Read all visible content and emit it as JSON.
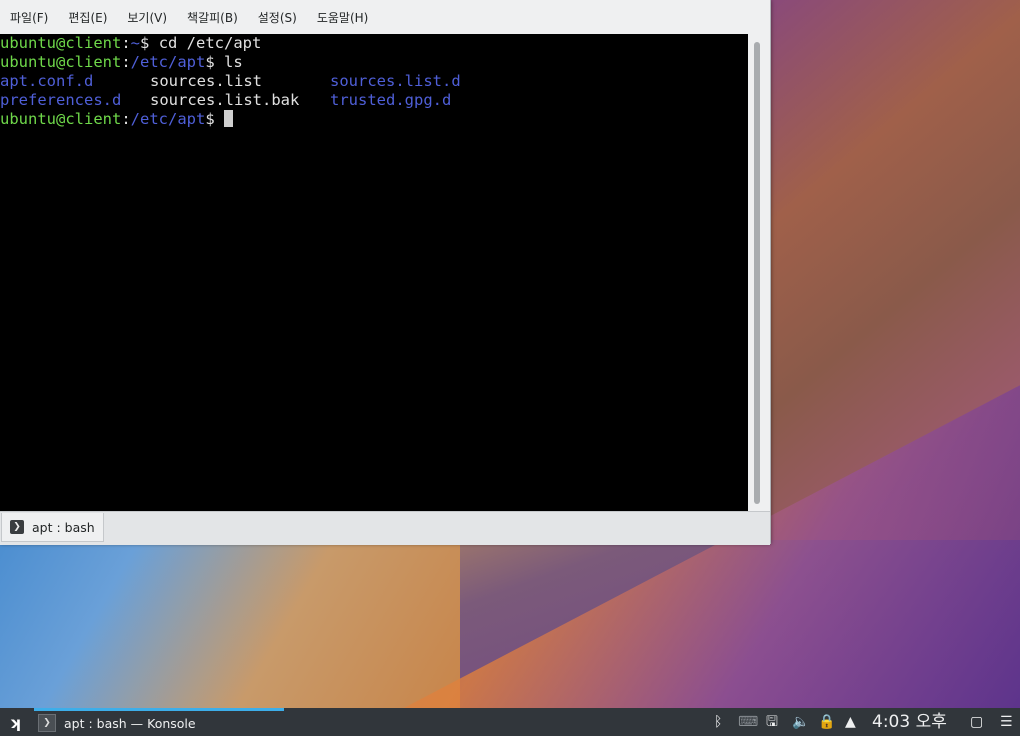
{
  "window": {
    "menu": [
      "파일(F)",
      "편집(E)",
      "보기(V)",
      "책갈피(B)",
      "설정(S)",
      "도움말(H)"
    ],
    "tab_label": "apt : bash"
  },
  "terminal": {
    "line1": {
      "user": "ubuntu@client",
      "sep": ":",
      "path": "~",
      "prompt": "$ ",
      "cmd": "cd /etc/apt"
    },
    "line2": {
      "user": "ubuntu@client",
      "sep": ":",
      "path": "/etc/apt",
      "prompt": "$ ",
      "cmd": "ls"
    },
    "ls_row1": [
      "apt.conf.d",
      "sources.list",
      "sources.list.d"
    ],
    "ls_row2": [
      "preferences.d",
      "sources.list.bak",
      "trusted.gpg.d"
    ],
    "line5": {
      "user": "ubuntu@client",
      "sep": ":",
      "path": "/etc/apt",
      "prompt": "$ "
    }
  },
  "taskbar": {
    "task_label": "apt : bash — Konsole",
    "clock": "4:03 오후",
    "tray_icons": [
      "bluetooth-icon",
      "keyboard-icon",
      "network-icon",
      "volume-icon",
      "lock-icon",
      "expand-tray-icon",
      "show-desktop-icon",
      "menu-icon"
    ]
  },
  "colors": {
    "terminal_bg": "#000000",
    "user_color": "#6fd84a",
    "dir_color": "#4f5fd8",
    "accent": "#3daee9"
  }
}
